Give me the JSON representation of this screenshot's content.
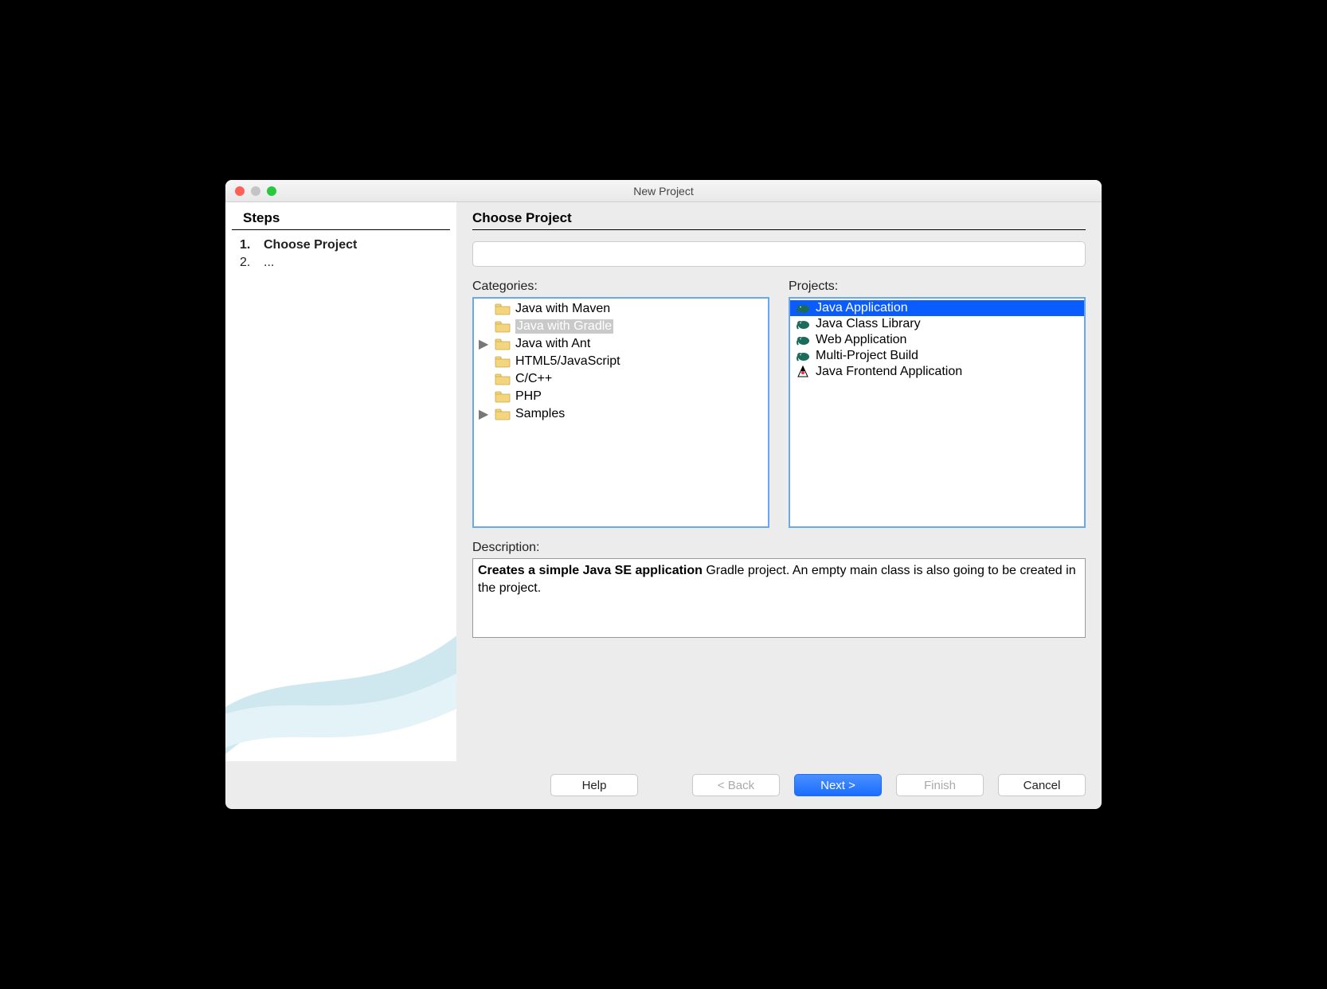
{
  "window": {
    "title": "New Project"
  },
  "sidebar": {
    "heading": "Steps",
    "steps": [
      {
        "num": "1.",
        "label": "Choose Project",
        "current": true
      },
      {
        "num": "2.",
        "label": "...",
        "current": false
      }
    ]
  },
  "main": {
    "heading": "Choose Project",
    "search_placeholder": "",
    "categories_label": "Categories:",
    "projects_label": "Projects:",
    "categories": [
      {
        "label": "Java with Maven",
        "expandable": false,
        "selected": false
      },
      {
        "label": "Java with Gradle",
        "expandable": false,
        "selected": true
      },
      {
        "label": "Java with Ant",
        "expandable": true,
        "selected": false
      },
      {
        "label": "HTML5/JavaScript",
        "expandable": false,
        "selected": false
      },
      {
        "label": "C/C++",
        "expandable": false,
        "selected": false
      },
      {
        "label": "PHP",
        "expandable": false,
        "selected": false
      },
      {
        "label": "Samples",
        "expandable": true,
        "selected": false
      }
    ],
    "projects": [
      {
        "label": "Java Application",
        "icon": "elephant",
        "selected": true
      },
      {
        "label": "Java Class Library",
        "icon": "elephant",
        "selected": false
      },
      {
        "label": "Web Application",
        "icon": "elephant",
        "selected": false
      },
      {
        "label": "Multi-Project Build",
        "icon": "elephant",
        "selected": false
      },
      {
        "label": "Java Frontend Application",
        "icon": "duke",
        "selected": false
      }
    ],
    "description_label": "Description:",
    "description_bold": "Creates a simple Java SE application",
    "description_rest": " Gradle project. An empty main class is also going to be created in the project."
  },
  "footer": {
    "help": "Help",
    "back": "< Back",
    "next": "Next >",
    "finish": "Finish",
    "cancel": "Cancel",
    "back_enabled": false,
    "finish_enabled": false
  }
}
